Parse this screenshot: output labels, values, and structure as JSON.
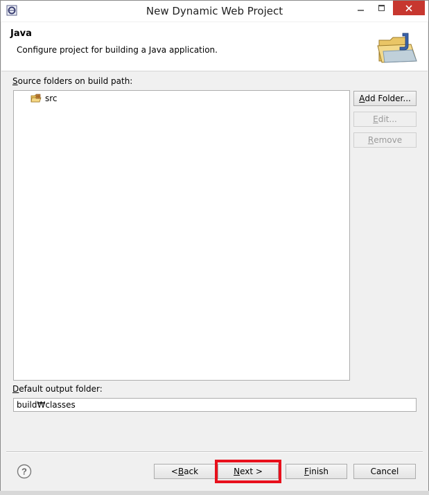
{
  "window": {
    "title": "New Dynamic Web Project"
  },
  "header": {
    "title": "Java",
    "description": "Configure project for building a Java application."
  },
  "source": {
    "label_mnemonic": "S",
    "label_rest": "ource folders on build path:",
    "items": [
      {
        "name": "src"
      }
    ]
  },
  "buttons": {
    "add_folder": {
      "mnemonic": "A",
      "rest": "dd Folder..."
    },
    "edit": {
      "mnemonic": "E",
      "rest": "dit..."
    },
    "remove": {
      "mnemonic": "R",
      "rest": "emove"
    },
    "back": {
      "pre": "< ",
      "mnemonic": "B",
      "rest": "ack"
    },
    "next": {
      "mnemonic": "N",
      "rest": "ext >"
    },
    "finish": {
      "mnemonic": "F",
      "rest": "inish"
    },
    "cancel": "Cancel"
  },
  "output": {
    "label_mnemonic": "D",
    "label_rest": "efault output folder:",
    "value": "build₩classes"
  },
  "colors": {
    "highlight": "#e8101c",
    "close_button": "#c7372f"
  }
}
